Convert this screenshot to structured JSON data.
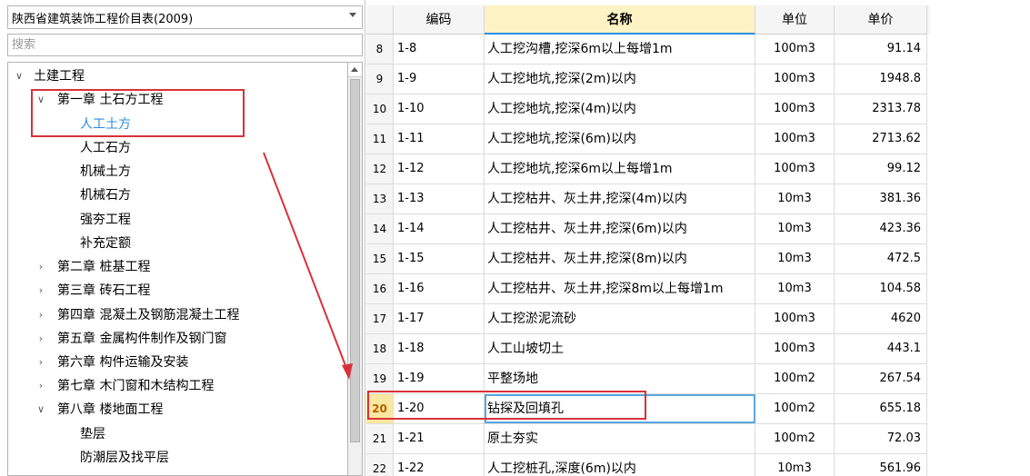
{
  "library_select": {
    "value": "陕西省建筑装饰工程价目表(2009)"
  },
  "search": {
    "placeholder": "搜索"
  },
  "tree": {
    "root": "土建工程",
    "chapter1": "第一章  土石方工程",
    "chapter1_children": [
      "人工土方",
      "人工石方",
      "机械土方",
      "机械石方",
      "强夯工程",
      "补充定额"
    ],
    "selected": "人工土方",
    "chapters": [
      "第二章  桩基工程",
      "第三章  砖石工程",
      "第四章  混凝土及钢筋混凝土工程",
      "第五章  金属构件制作及钢门窗",
      "第六章  构件运输及安装",
      "第七章  木门窗和木结构工程"
    ],
    "chapter8": "第八章  楼地面工程",
    "chapter8_children": [
      "垫层",
      "防潮层及找平层"
    ]
  },
  "table": {
    "headers": [
      "",
      "编码",
      "名称",
      "单位",
      "单价"
    ],
    "active_header": "名称",
    "current_row": "20",
    "rows": [
      [
        "8",
        "1-8",
        "人工挖沟槽,挖深6m以上每增1m",
        "100m3",
        "91.14"
      ],
      [
        "9",
        "1-9",
        "人工挖地坑,挖深(2m)以内",
        "100m3",
        "1948.8"
      ],
      [
        "10",
        "1-10",
        "人工挖地坑,挖深(4m)以内",
        "100m3",
        "2313.78"
      ],
      [
        "11",
        "1-11",
        "人工挖地坑,挖深(6m)以内",
        "100m3",
        "2713.62"
      ],
      [
        "12",
        "1-12",
        "人工挖地坑,挖深6m以上每增1m",
        "100m3",
        "99.12"
      ],
      [
        "13",
        "1-13",
        "人工挖枯井、灰土井,挖深(4m)以内",
        "10m3",
        "381.36"
      ],
      [
        "14",
        "1-14",
        "人工挖枯井、灰土井,挖深(6m)以内",
        "10m3",
        "423.36"
      ],
      [
        "15",
        "1-15",
        "人工挖枯井、灰土井,挖深(8m)以内",
        "10m3",
        "472.5"
      ],
      [
        "16",
        "1-16",
        "人工挖枯井、灰土井,挖深8m以上每增1m",
        "10m3",
        "104.58"
      ],
      [
        "17",
        "1-17",
        "人工挖淤泥流砂",
        "100m3",
        "4620"
      ],
      [
        "18",
        "1-18",
        "人工山坡切土",
        "100m3",
        "443.1"
      ],
      [
        "19",
        "1-19",
        "平整场地",
        "100m2",
        "267.54"
      ],
      [
        "20",
        "1-20",
        "钻探及回填孔",
        "100m2",
        "655.18"
      ],
      [
        "21",
        "1-21",
        "原土夯实",
        "100m2",
        "72.03"
      ],
      [
        "22",
        "1-22",
        "人工挖桩孔,深度(6m)以内",
        "10m3",
        "561.96"
      ]
    ]
  },
  "colors": {
    "annotation": "#d9313a",
    "selection": "#2a8de0",
    "active_header_bg": "#fdf3c4"
  }
}
